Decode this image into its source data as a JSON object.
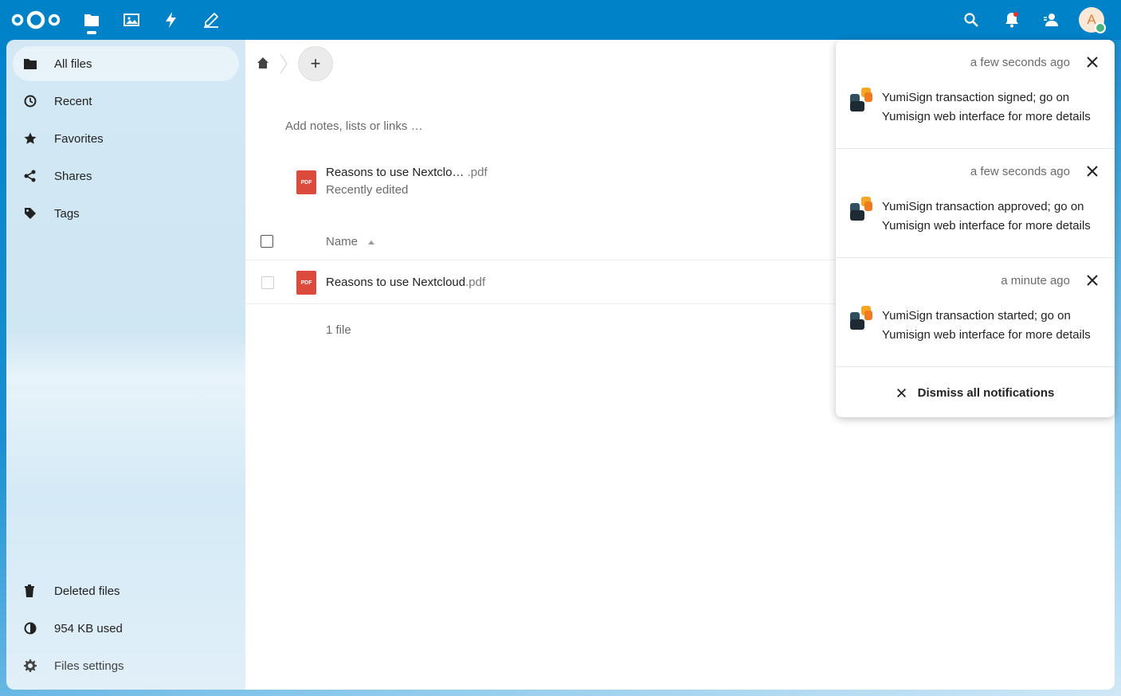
{
  "header": {
    "logo": "nextcloud-logo",
    "apps": [
      {
        "name": "files",
        "icon": "folder-icon",
        "active": true
      },
      {
        "name": "photos",
        "icon": "image-icon",
        "active": false
      },
      {
        "name": "activity",
        "icon": "lightning-icon",
        "active": false
      },
      {
        "name": "notes",
        "icon": "pen-icon",
        "active": false
      }
    ],
    "avatar_initial": "A",
    "accent_color": "#0082c9"
  },
  "sidebar": {
    "items": [
      {
        "label": "All files",
        "icon": "folder-icon",
        "active": true
      },
      {
        "label": "Recent",
        "icon": "clock-icon"
      },
      {
        "label": "Favorites",
        "icon": "star-icon"
      },
      {
        "label": "Shares",
        "icon": "share-icon"
      },
      {
        "label": "Tags",
        "icon": "tag-icon"
      }
    ],
    "bottom": [
      {
        "label": "Deleted files",
        "icon": "trash-icon"
      },
      {
        "label": "954 KB used",
        "icon": "pie-chart-icon"
      },
      {
        "label": "Files settings",
        "icon": "gear-icon"
      }
    ]
  },
  "main": {
    "notes_placeholder": "Add notes, lists or links …",
    "recent": {
      "name": "Reasons to use Nextclo…",
      "ext": " .pdf",
      "subtitle": "Recently edited",
      "type_label": "PDF"
    },
    "table": {
      "name_header": "Name",
      "files": [
        {
          "name": "Reasons to use Nextcloud",
          "ext": ".pdf",
          "type_label": "PDF"
        }
      ],
      "summary": "1 file"
    }
  },
  "notifications": {
    "items": [
      {
        "time": "a few seconds ago",
        "text": "YumiSign transaction signed; go on Yumisign web interface for more details"
      },
      {
        "time": "a few seconds ago",
        "text": "YumiSign transaction approved; go on Yumisign web interface for more details"
      },
      {
        "time": "a minute ago",
        "text": "YumiSign transaction started; go on Yumisign web interface for more details"
      }
    ],
    "dismiss_all": "Dismiss all notifications"
  }
}
